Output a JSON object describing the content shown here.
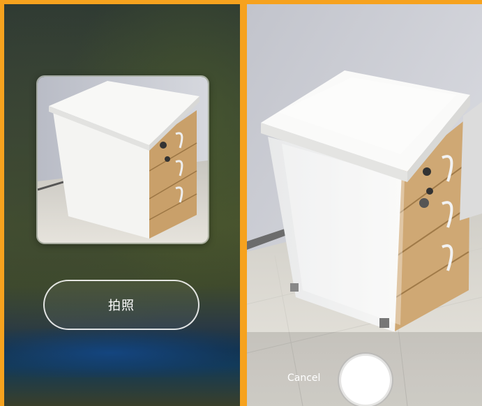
{
  "left_screen": {
    "preview": {
      "icon": "photo-thumbnail-cabinet"
    },
    "capture_button": {
      "label": "拍照"
    }
  },
  "right_screen": {
    "viewfinder": {
      "icon": "camera-viewfinder-cabinet"
    },
    "cancel_label": "Cancel",
    "shutter": {
      "icon": "shutter-button"
    }
  },
  "colors": {
    "frame_accent": "#f6a21e"
  }
}
